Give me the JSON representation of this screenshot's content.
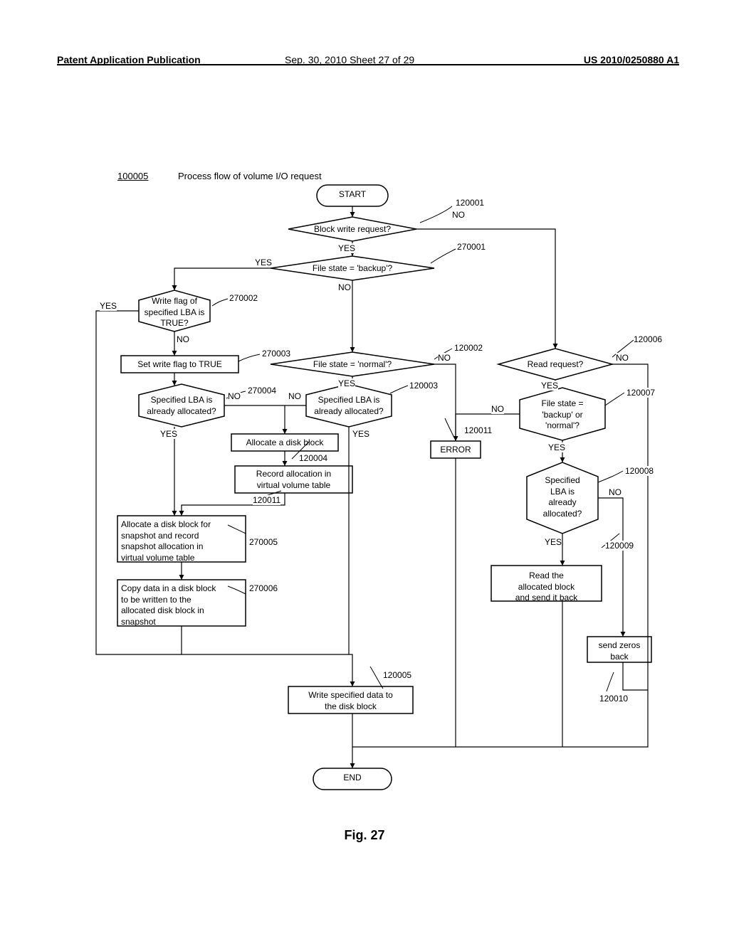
{
  "header": {
    "left": "Patent Application Publication",
    "mid": "Sep. 30, 2010  Sheet 27 of 29",
    "right": "US 2010/0250880 A1"
  },
  "figure": {
    "id": "100005",
    "title": "Process flow of volume I/O request",
    "caption": "Fig. 27"
  },
  "nodes": {
    "start": "START",
    "end": "END",
    "d120001": "Block write request?",
    "d270001": "File state = 'backup'?",
    "d270002": "Write flag of\nspecified LBA is\nTRUE?",
    "p270003": "Set write flag to TRUE",
    "d270004": "Specified LBA is\nalready allocated?",
    "p270005": "Allocate a disk block for\nsnapshot and record\nsnapshot allocation in\nvirtual volume table",
    "p270006": "Copy data in a disk block\nto be written to the\nallocated disk block in\nsnapshot",
    "d120002": "File state = 'normal'?",
    "d120003": "Specified LBA is\nalready allocated?",
    "p120004a": "Allocate a disk block",
    "p120004b": "Record allocation in\nvirtual volume table",
    "p120005": "Write specified data to\nthe disk block",
    "d120006": "Read request?",
    "d120007": "File state =\n'backup' or\n'normal'?",
    "d120008": "Specified\nLBA is\nalready\nallocated?",
    "p120009": "Read the\nallocated block\nand send it back",
    "p120010": "send zeros\nback",
    "p120011": "ERROR"
  },
  "labels": {
    "yes": "YES",
    "no": "NO"
  },
  "refs": {
    "r120001": "120001",
    "r270001": "270001",
    "r270002": "270002",
    "r270003": "270003",
    "r270004": "270004",
    "r270005": "270005",
    "r270006": "270006",
    "r120002": "120002",
    "r120003": "120003",
    "r120004": "120004",
    "r120005": "120005",
    "r120006": "120006",
    "r120007": "120007",
    "r120008": "120008",
    "r120009": "120009",
    "r120010": "120010",
    "r120011a": "120011",
    "r120011b": "120011"
  }
}
